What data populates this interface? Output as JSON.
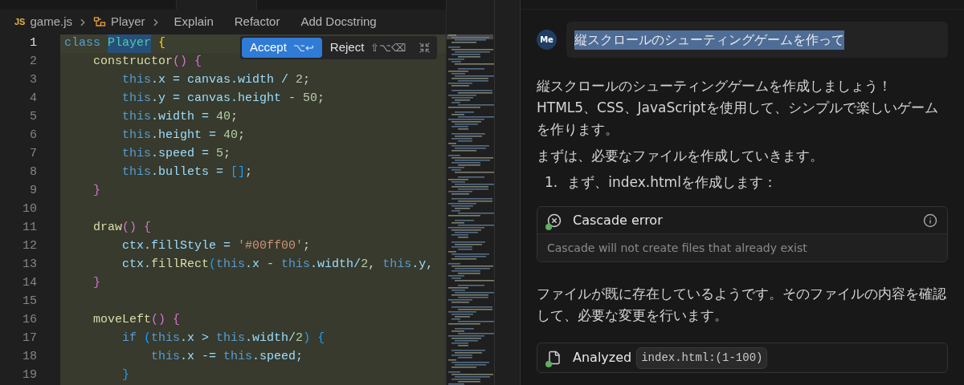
{
  "breadcrumbs": [
    {
      "label": "game.js",
      "kind": "file",
      "badge": "JS"
    },
    {
      "label": "Player",
      "kind": "symbol"
    }
  ],
  "code_actions": [
    "Explain",
    "Refactor",
    "Add Docstring"
  ],
  "diff_toolbar": {
    "accept": {
      "label": "Accept",
      "shortcut": "⌥↩"
    },
    "reject": {
      "label": "Reject",
      "shortcut": "⇧⌥⌫"
    }
  },
  "editor": {
    "lines": [
      {
        "number": "1",
        "current": true,
        "tokens": [
          {
            "text": "class ",
            "kind": "kw"
          },
          {
            "text": "Player",
            "kind": "cls_hl"
          },
          {
            "text": " {",
            "kind": "b1"
          }
        ]
      },
      {
        "number": "2",
        "current": false,
        "tokens": [
          {
            "text": "    constructor",
            "kind": "fn"
          },
          {
            "text": "() {",
            "kind": "b2"
          }
        ]
      },
      {
        "number": "3",
        "current": false,
        "tokens": [
          {
            "text": "        this",
            "kind": "this"
          },
          {
            "text": ".x = canvas.width / ",
            "kind": "p"
          },
          {
            "text": "2",
            "kind": "num"
          },
          {
            "text": ";",
            "kind": "op"
          }
        ]
      },
      {
        "number": "4",
        "current": false,
        "tokens": [
          {
            "text": "        this",
            "kind": "this"
          },
          {
            "text": ".y = canvas.height - ",
            "kind": "p"
          },
          {
            "text": "50",
            "kind": "num"
          },
          {
            "text": ";",
            "kind": "op"
          }
        ]
      },
      {
        "number": "5",
        "current": false,
        "tokens": [
          {
            "text": "        this",
            "kind": "this"
          },
          {
            "text": ".width = ",
            "kind": "p"
          },
          {
            "text": "40",
            "kind": "num"
          },
          {
            "text": ";",
            "kind": "op"
          }
        ]
      },
      {
        "number": "6",
        "current": false,
        "tokens": [
          {
            "text": "        this",
            "kind": "this"
          },
          {
            "text": ".height = ",
            "kind": "p"
          },
          {
            "text": "40",
            "kind": "num"
          },
          {
            "text": ";",
            "kind": "op"
          }
        ]
      },
      {
        "number": "7",
        "current": false,
        "tokens": [
          {
            "text": "        this",
            "kind": "this"
          },
          {
            "text": ".speed = ",
            "kind": "p"
          },
          {
            "text": "5",
            "kind": "num"
          },
          {
            "text": ";",
            "kind": "op"
          }
        ]
      },
      {
        "number": "8",
        "current": false,
        "tokens": [
          {
            "text": "        this",
            "kind": "this"
          },
          {
            "text": ".bullets = ",
            "kind": "p"
          },
          {
            "text": "[]",
            "kind": "b3"
          },
          {
            "text": ";",
            "kind": "op"
          }
        ]
      },
      {
        "number": "9",
        "current": false,
        "tokens": [
          {
            "text": "    }",
            "kind": "b2"
          }
        ]
      },
      {
        "number": "10",
        "current": false
      },
      {
        "number": "11",
        "current": false,
        "tokens": [
          {
            "text": "    draw",
            "kind": "fn"
          },
          {
            "text": "() {",
            "kind": "b2"
          }
        ]
      },
      {
        "number": "12",
        "current": false,
        "tokens": [
          {
            "text": "        ctx.",
            "kind": "p"
          },
          {
            "text": "fillStyle = ",
            "kind": "p"
          },
          {
            "text": "'#00ff00'",
            "kind": "str"
          },
          {
            "text": ";",
            "kind": "op"
          }
        ]
      },
      {
        "number": "13",
        "current": false,
        "tokens": [
          {
            "text": "        ctx.",
            "kind": "p"
          },
          {
            "text": "fillRect",
            "kind": "fn"
          },
          {
            "text": "(",
            "kind": "b3"
          },
          {
            "text": "this",
            "kind": "this"
          },
          {
            "text": ".x - ",
            "kind": "p"
          },
          {
            "text": "this",
            "kind": "this"
          },
          {
            "text": ".width/",
            "kind": "p"
          },
          {
            "text": "2",
            "kind": "num"
          },
          {
            "text": ", ",
            "kind": "op"
          },
          {
            "text": "this",
            "kind": "this"
          },
          {
            "text": ".y,",
            "kind": "p"
          }
        ]
      },
      {
        "number": "14",
        "current": false,
        "tokens": [
          {
            "text": "    }",
            "kind": "b2"
          }
        ]
      },
      {
        "number": "15",
        "current": false
      },
      {
        "number": "16",
        "current": false,
        "tokens": [
          {
            "text": "    moveLeft",
            "kind": "fn"
          },
          {
            "text": "() {",
            "kind": "b2"
          }
        ]
      },
      {
        "number": "17",
        "current": false,
        "tokens": [
          {
            "text": "        if ",
            "kind": "kw"
          },
          {
            "text": "(",
            "kind": "b3"
          },
          {
            "text": "this",
            "kind": "this"
          },
          {
            "text": ".x > ",
            "kind": "p"
          },
          {
            "text": "this",
            "kind": "this"
          },
          {
            "text": ".width/",
            "kind": "p"
          },
          {
            "text": "2",
            "kind": "num"
          },
          {
            "text": ") {",
            "kind": "b3"
          }
        ]
      },
      {
        "number": "18",
        "current": false,
        "tokens": [
          {
            "text": "            this",
            "kind": "this"
          },
          {
            "text": ".x -= ",
            "kind": "p"
          },
          {
            "text": "this",
            "kind": "this"
          },
          {
            "text": ".speed;",
            "kind": "p"
          }
        ]
      },
      {
        "number": "19",
        "current": false,
        "tokens": [
          {
            "text": "        }",
            "kind": "b3"
          }
        ]
      }
    ]
  },
  "chat": {
    "user_message": {
      "avatar": "Me",
      "text": "縦スクロールのシューティングゲームを作って",
      "selected": true
    },
    "messages": [
      {
        "kind": "paragraph",
        "text": "縦スクロールのシューティングゲームを作成しましょう！\nHTML5、CSS、JavaScriptを使用して、シンプルで楽しいゲームを作ります。"
      },
      {
        "kind": "paragraph",
        "text": "まずは、必要なファイルを作成していきます。"
      },
      {
        "kind": "ordered_item",
        "number": "1.",
        "text": "まず、index.htmlを作成します："
      },
      {
        "kind": "error_card",
        "title": "Cascade error",
        "detail": "Cascade will not create files that already exist"
      },
      {
        "kind": "paragraph",
        "text": "ファイルが既に存在しているようです。そのファイルの内容を確認して、必要な変更を行います。"
      },
      {
        "kind": "tool_card",
        "label": "Analyzed",
        "target": "index.html:(1-100)"
      }
    ]
  }
}
